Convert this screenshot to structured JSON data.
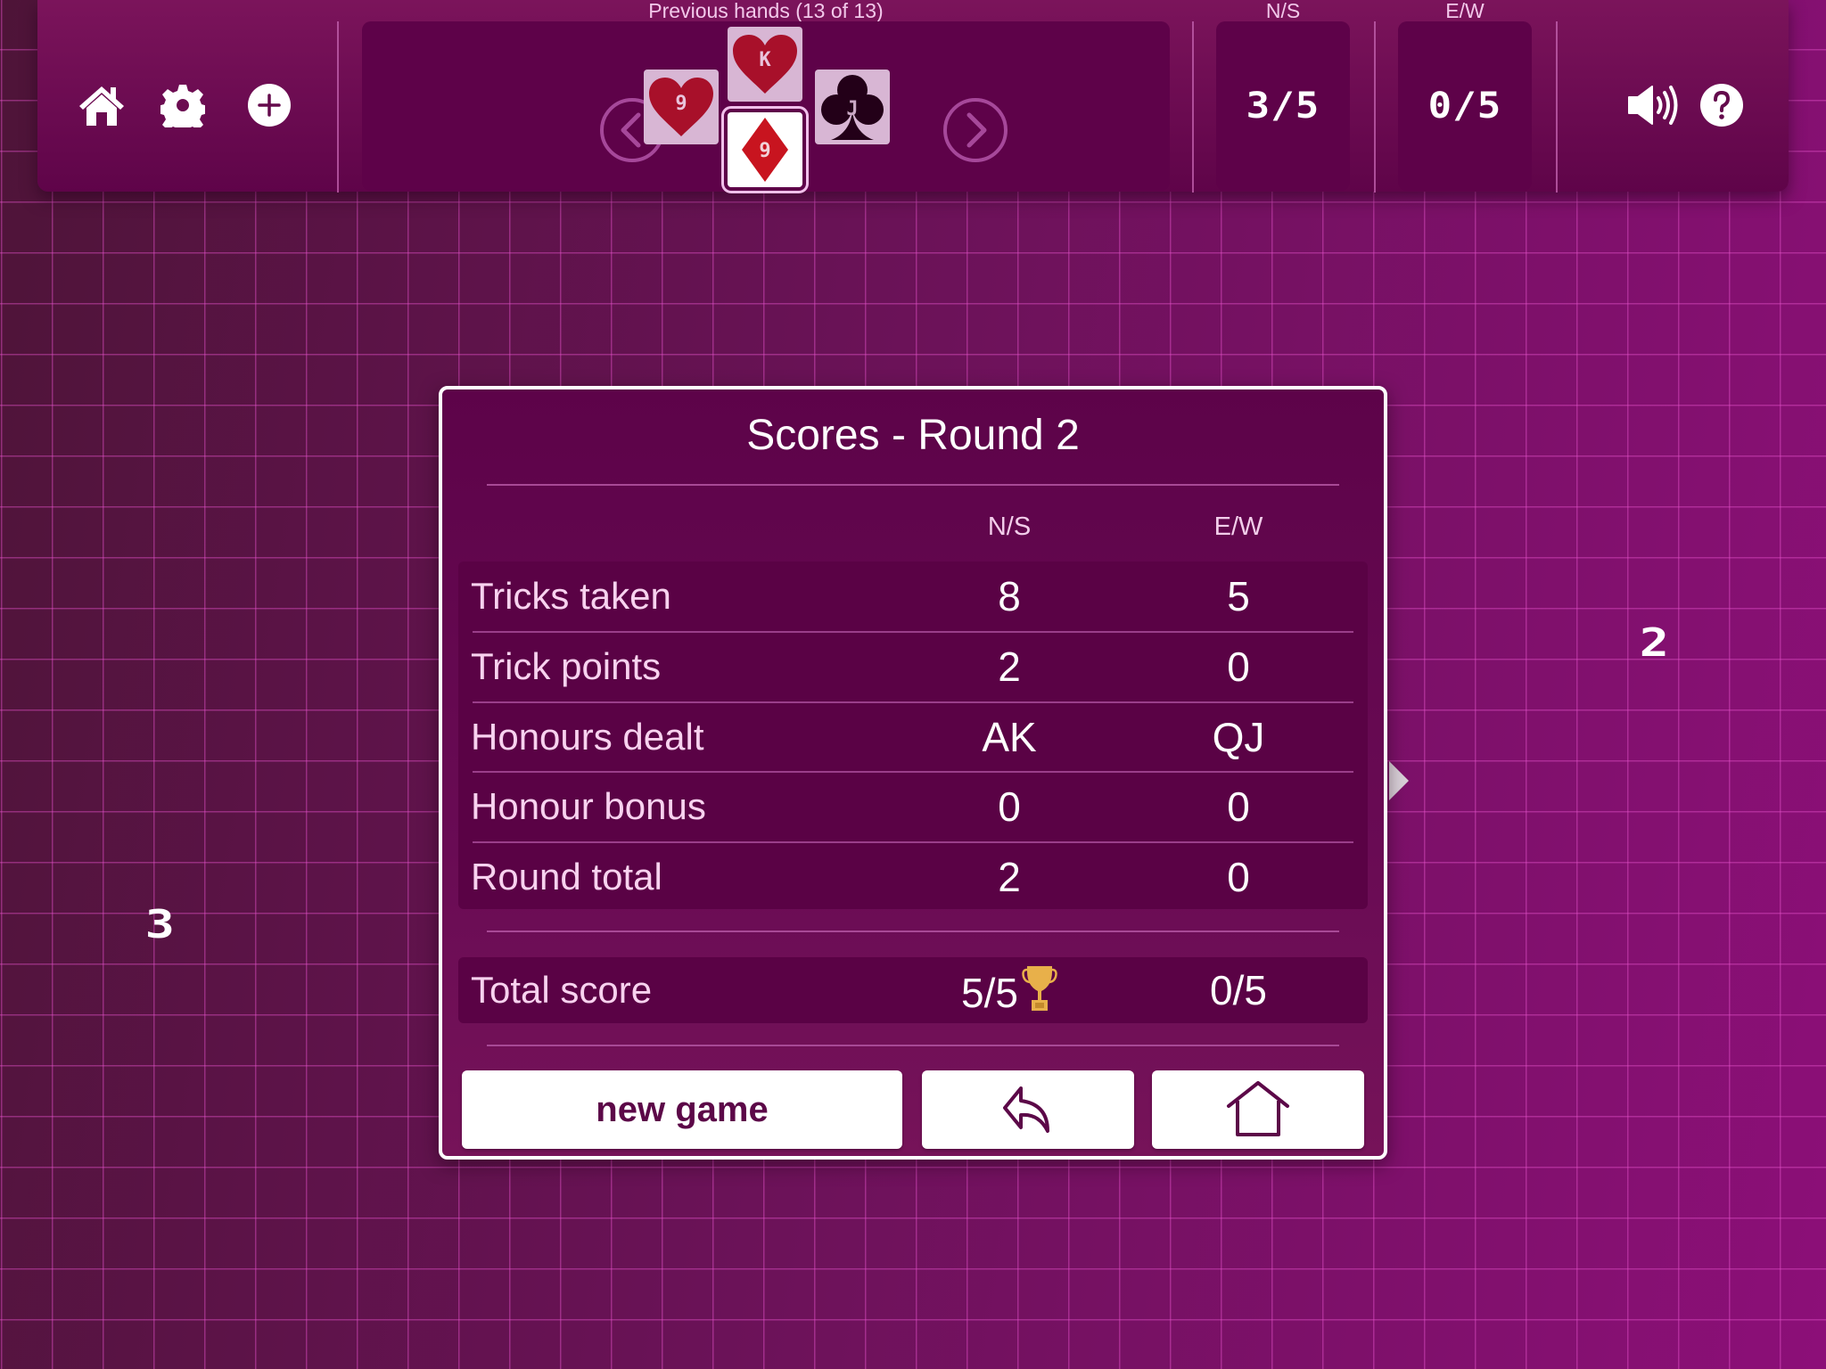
{
  "toolbar": {
    "left_icons": [
      {
        "name": "home-icon",
        "label": "Home"
      },
      {
        "name": "gear-icon",
        "label": "Settings"
      },
      {
        "name": "plus-circle-icon",
        "label": "New"
      }
    ],
    "previous_hands_label": "Previous hands (13 of 13)",
    "prev_arrow": "chevron-left-icon",
    "next_arrow": "chevron-right-icon",
    "trick_cards": [
      {
        "seat": "west",
        "rank": "9",
        "suit": "hearts",
        "color": "#a8102a"
      },
      {
        "seat": "north",
        "rank": "K",
        "suit": "hearts",
        "color": "#a8102a"
      },
      {
        "seat": "south",
        "rank": "9",
        "suit": "diamonds",
        "color": "#c8141f",
        "current": true
      },
      {
        "seat": "east",
        "rank": "J",
        "suit": "clubs",
        "color": "#230018"
      }
    ],
    "ns_label": "N/S",
    "ns_score": "3/5",
    "ew_label": "E/W",
    "ew_score": "0/5",
    "right_icons": [
      {
        "name": "speaker-icon",
        "label": "Sound"
      },
      {
        "name": "help-icon",
        "label": "Help"
      }
    ]
  },
  "seats": {
    "east_label": "2",
    "west_label": "3"
  },
  "dialog": {
    "title": "Scores - Round 2",
    "col_ns": "N/S",
    "col_ew": "E/W",
    "rows": [
      {
        "label": "Tricks taken",
        "ns": "8",
        "ew": "5"
      },
      {
        "label": "Trick points",
        "ns": "2",
        "ew": "0"
      },
      {
        "label": "Honours dealt",
        "ns": "AK",
        "ew": "QJ"
      },
      {
        "label": "Honour bonus",
        "ns": "0",
        "ew": "0"
      },
      {
        "label": "Round total",
        "ns": "2",
        "ew": "0"
      }
    ],
    "total": {
      "label": "Total score",
      "ns": "5/5",
      "ew": "0/5",
      "winner_icon": "trophy-icon"
    },
    "buttons": {
      "new_game": "new game",
      "back_icon": "reply-arrow-icon",
      "home_icon": "home-outline-icon"
    }
  },
  "colors": {
    "accent": "#5f0449",
    "grid": "#e250c8",
    "trophy": "#e8b04a"
  }
}
